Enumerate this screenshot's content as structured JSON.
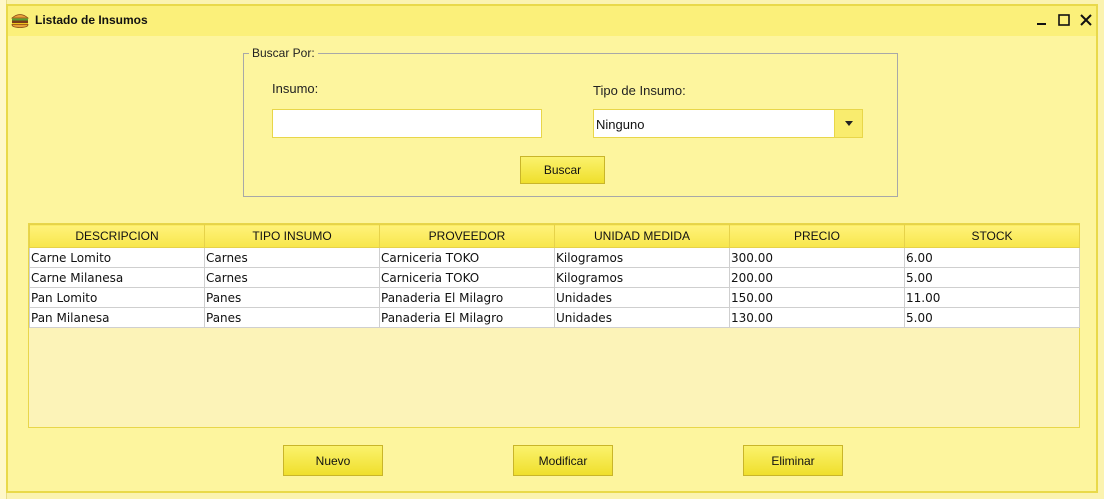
{
  "window": {
    "title": "Listado de Insumos"
  },
  "search": {
    "group_label": "Buscar Por:",
    "insumo_label": "Insumo:",
    "insumo_value": "",
    "tipo_label": "Tipo de Insumo:",
    "tipo_selected": "Ninguno",
    "button_label": "Buscar"
  },
  "table": {
    "headers": [
      "DESCRIPCION",
      "TIPO INSUMO",
      "PROVEEDOR",
      "UNIDAD MEDIDA",
      "PRECIO",
      "STOCK"
    ],
    "rows": [
      [
        "Carne Lomito",
        "Carnes",
        "Carniceria TOKO",
        "Kilogramos",
        "300.00",
        "6.00"
      ],
      [
        "Carne Milanesa",
        "Carnes",
        "Carniceria TOKO",
        "Kilogramos",
        "200.00",
        "5.00"
      ],
      [
        "Pan Lomito",
        "Panes",
        "Panaderia El Milagro",
        "Unidades",
        "150.00",
        "11.00"
      ],
      [
        "Pan Milanesa",
        "Panes",
        "Panaderia El Milagro",
        "Unidades",
        "130.00",
        "5.00"
      ]
    ]
  },
  "actions": {
    "new_label": "Nuevo",
    "edit_label": "Modificar",
    "delete_label": "Eliminar"
  },
  "icons": {
    "app": "burger-icon",
    "minimize": "minimize-icon",
    "maximize": "maximize-icon",
    "close": "close-icon",
    "dropdown": "chevron-down-icon"
  },
  "colors": {
    "window_bg": "#fdf59e",
    "titlebar": "#fbf07a",
    "button": "#f3e444",
    "border_accent": "#e8d64a"
  }
}
